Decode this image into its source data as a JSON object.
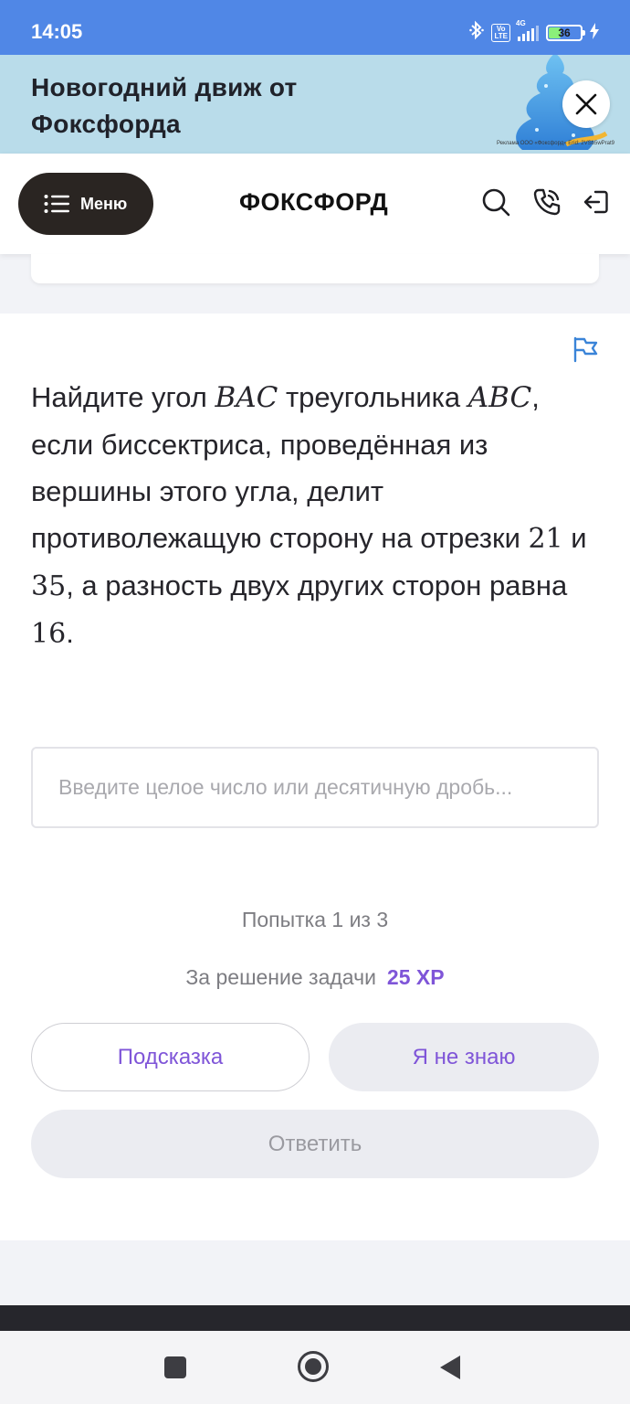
{
  "status_bar": {
    "time": "14:05",
    "volte_label": "Vo\nLTE",
    "network_label": "4G",
    "battery_level": "36",
    "icons": [
      "bluetooth-icon",
      "volte-icon",
      "signal-icon",
      "battery-icon",
      "charging-icon"
    ]
  },
  "banner": {
    "title": "Новогодний движ от Фоксфорда",
    "legal_text": "Реклама ООО «Фоксфорд» Erid: 2VSb5wPrat9",
    "close_icon": "close-icon"
  },
  "header": {
    "menu_label": "Меню",
    "logo_text": "ФОКСФОРД",
    "icons": [
      "search-icon",
      "phone-icon",
      "login-icon"
    ]
  },
  "task": {
    "question_parts": {
      "p1": "Найдите угол ",
      "m1": "BAC",
      "p2": " треугольника ",
      "m2": "ABC",
      "p3": ", если биссектриса, проведённая из вершины этого угла, делит противолежащую сторону на отрезки ",
      "n1": "21",
      "p4": " и ",
      "n2": "35",
      "p5": ", а разность двух других сторон равна ",
      "n3": "16",
      "p6": "."
    },
    "answer_value": "",
    "answer_placeholder": "Введите целое число или десятичную дробь...",
    "attempt_text": "Попытка 1 из 3",
    "reward_label": "За решение задачи",
    "reward_value": "25 XP",
    "hint_button": "Подсказка",
    "dunno_button": "Я не знаю",
    "answer_button": "Ответить"
  },
  "colors": {
    "status_bar": "#5087e6",
    "banner_bg": "#b9dcea",
    "accent": "#7f55d8",
    "menu_button": "#2a2522"
  }
}
